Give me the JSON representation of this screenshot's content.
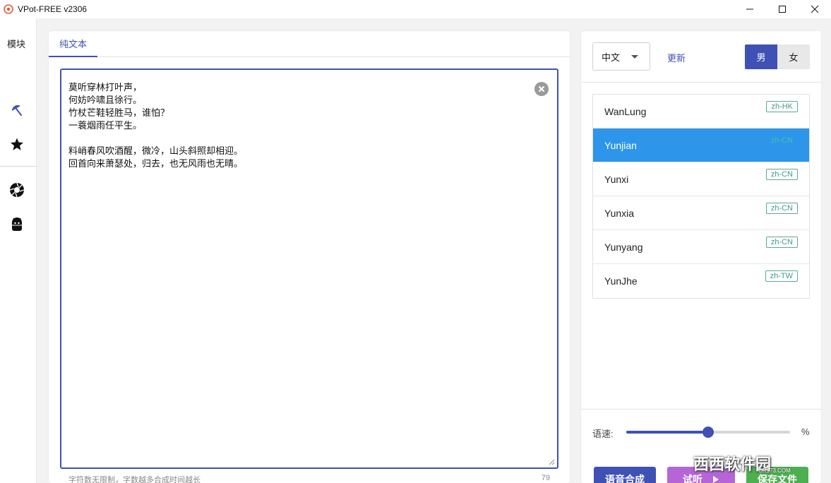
{
  "window": {
    "title": "VPot-FREE v2306",
    "minimize_glyph": "—",
    "maximize_glyph": "☐",
    "close_glyph": "✕"
  },
  "nav": {
    "title": "模块",
    "items": [
      {
        "icon": "umbrella-icon"
      },
      {
        "icon": "star-icon"
      },
      {
        "icon": "aperture-icon"
      },
      {
        "icon": "android-icon"
      }
    ]
  },
  "editor": {
    "tab_label": "纯文本",
    "lines": [
      "莫听穿林打叶声，",
      "何妨吟啸且徐行。",
      "竹杖芒鞋轻胜马，谁怕？",
      "一蓑烟雨任平生。",
      "",
      "料峭春风吹酒醒，微冷，山头斜照却相迎。",
      "回首向来萧瑟处，归去，也无风雨也无晴。"
    ],
    "hint": "字符数无限制，字数越多合成时间越长",
    "char_count": "79"
  },
  "voice_panel": {
    "language": "中文",
    "update_label": "更新",
    "gender_male": "男",
    "gender_female": "女",
    "selected_gender": "男",
    "voices": [
      {
        "name": "WanLung",
        "tag": "zh-HK",
        "selected": false
      },
      {
        "name": "Yunjian",
        "tag": "zh-CN",
        "selected": true
      },
      {
        "name": "Yunxi",
        "tag": "zh-CN",
        "selected": false
      },
      {
        "name": "Yunxia",
        "tag": "zh-CN",
        "selected": false
      },
      {
        "name": "Yunyang",
        "tag": "zh-CN",
        "selected": false
      },
      {
        "name": "YunJhe",
        "tag": "zh-TW",
        "selected": false
      }
    ],
    "speed_label": "语速:",
    "speed_unit": "%",
    "speed_fraction": 0.5
  },
  "actions": {
    "synthesize": "语音合成",
    "preview": "试听",
    "save": "保存文件"
  },
  "watermark": {
    "logo": "西西软件园",
    "sub": "CR173.COM"
  },
  "colors": {
    "accent": "#3f51b5",
    "selected_row": "#2d96ea",
    "tag_text": "#3e9a8a",
    "preview_button": "#b565d6",
    "save_button": "#4caf50"
  }
}
